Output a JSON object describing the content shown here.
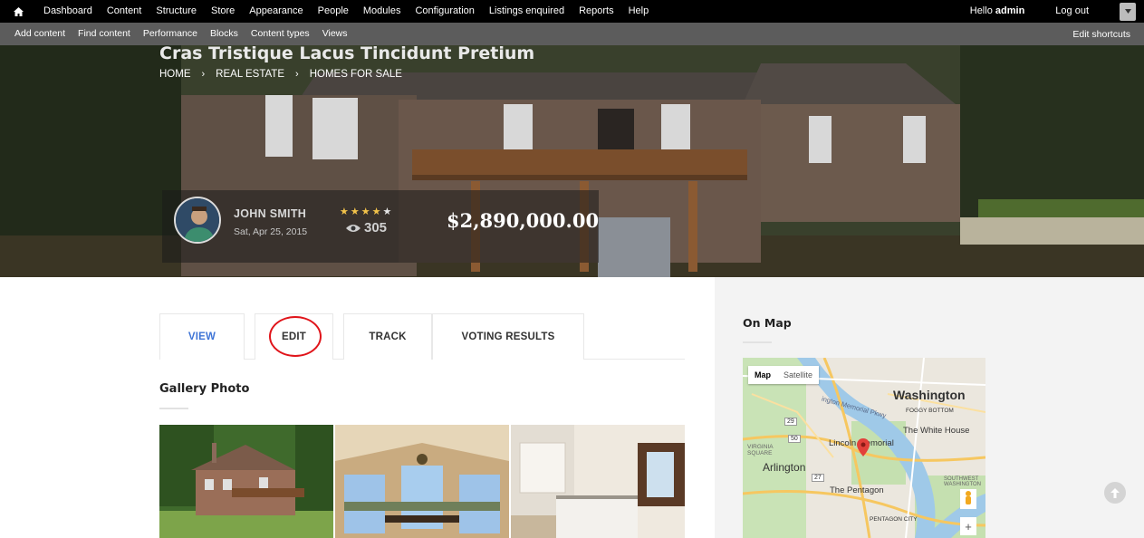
{
  "admin_toolbar": {
    "menu": [
      "Dashboard",
      "Content",
      "Structure",
      "Store",
      "Appearance",
      "People",
      "Modules",
      "Configuration",
      "Listings enquired",
      "Reports",
      "Help"
    ],
    "greeting": "Hello",
    "username": "admin",
    "logout": "Log out"
  },
  "shortcuts": {
    "items": [
      "Add content",
      "Find content",
      "Performance",
      "Blocks",
      "Content types",
      "Views"
    ],
    "edit": "Edit shortcuts"
  },
  "hero": {
    "title": "Cras Tristique Lacus Tincidunt Pretium",
    "breadcrumb": [
      "HOME",
      "REAL ESTATE",
      "HOMES FOR SALE"
    ],
    "agent_name": "JOHN SMITH",
    "date": "Sat, Apr 25, 2015",
    "rating": 4,
    "rating_max": 5,
    "views": "305",
    "price": "$2,890,000.00"
  },
  "tabs": [
    "VIEW",
    "EDIT",
    "TRACK",
    "VOTING RESULTS"
  ],
  "active_tab": "VIEW",
  "gallery": {
    "title": "Gallery Photo"
  },
  "sidebar": {
    "title": "On Map",
    "map_types": [
      "Map",
      "Satellite"
    ],
    "map_labels": {
      "washington": "Washington",
      "foggy_bottom": "FOGGY BOTTOM",
      "memorial_pkwy": "ington Memorial Pkwy",
      "white_house": "The White House",
      "lincoln": "Lincoln Memorial",
      "virginia_square": "VIRGINIA\nSQUARE",
      "arlington": "Arlington",
      "pentagon": "The Pentagon",
      "pentagon_city": "PENTAGON CITY",
      "southwest": "SOUTHWEST\nWASHINGTON",
      "route_29": "29",
      "route_50": "50",
      "route_27": "27"
    },
    "zoom_in": "+"
  },
  "colors": {
    "accent": "#3e74d6",
    "highlight_circle": "#e0141a",
    "star": "#f3c34a"
  }
}
